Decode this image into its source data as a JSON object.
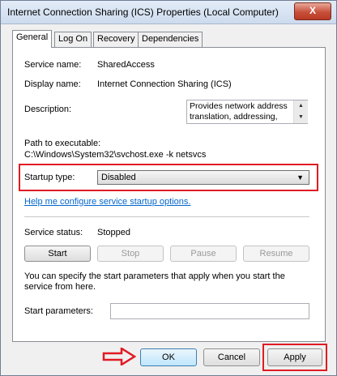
{
  "window": {
    "title": "Internet Connection Sharing (ICS) Properties (Local Computer)",
    "close_label": "X"
  },
  "tabs": [
    {
      "label": "General",
      "active": true
    },
    {
      "label": "Log On",
      "active": false
    },
    {
      "label": "Recovery",
      "active": false
    },
    {
      "label": "Dependencies",
      "active": false
    }
  ],
  "general": {
    "service_name_label": "Service name:",
    "service_name_value": "SharedAccess",
    "display_name_label": "Display name:",
    "display_name_value": "Internet Connection Sharing (ICS)",
    "description_label": "Description:",
    "description_value": "Provides network address translation, addressing, name resolution and/or intrusion prevention services",
    "path_label": "Path to executable:",
    "path_value": "C:\\Windows\\System32\\svchost.exe -k netsvcs",
    "startup_type_label": "Startup type:",
    "startup_type_value": "Disabled",
    "help_link": "Help me configure service startup options.",
    "service_status_label": "Service status:",
    "service_status_value": "Stopped",
    "buttons": {
      "start": "Start",
      "stop": "Stop",
      "pause": "Pause",
      "resume": "Resume"
    },
    "start_params_note": "You can specify the start parameters that apply when you start the service from here.",
    "start_params_label": "Start parameters:",
    "start_params_value": ""
  },
  "footer": {
    "ok": "OK",
    "cancel": "Cancel",
    "apply": "Apply"
  },
  "colors": {
    "highlight": "#e01b24",
    "link": "#0066cc"
  },
  "icons": [
    "close-icon",
    "dropdown-arrow-icon",
    "scroll-up-icon",
    "scroll-down-icon",
    "pointer-arrow-icon"
  ]
}
